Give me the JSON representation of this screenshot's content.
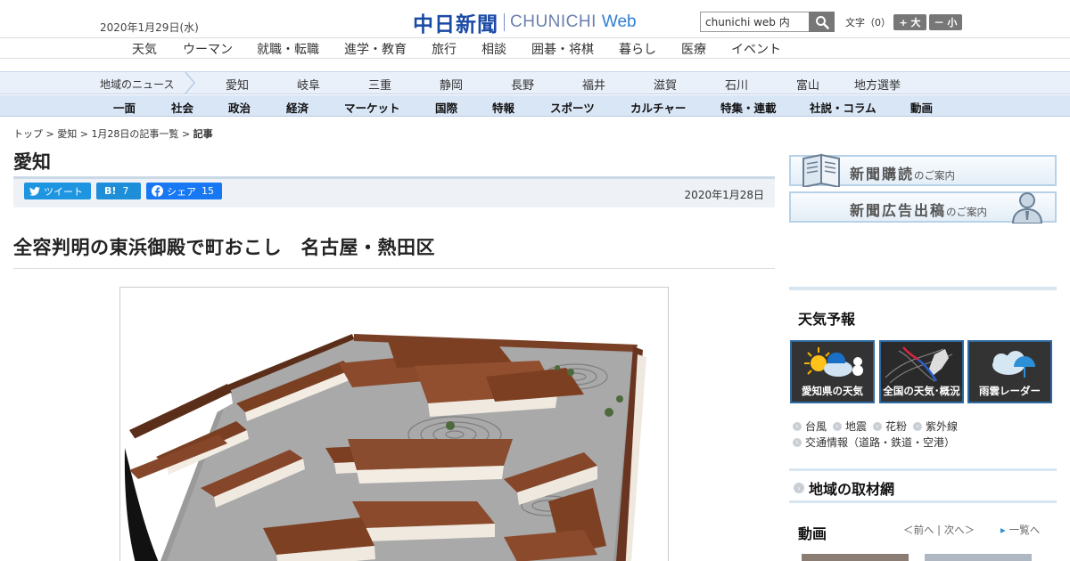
{
  "header": {
    "date": "2020年1月29日(水)",
    "logo_jp": "中日新聞",
    "logo_en": "CHUNICHI",
    "logo_web": "Web",
    "search_value": "chunichi web 内",
    "font_size_label": "文字（0）",
    "font_large": "+ 大",
    "font_small": "－ 小"
  },
  "category_nav": [
    "天気",
    "ウーマン",
    "就職・転職",
    "進学・教育",
    "旅行",
    "相談",
    "囲碁・将棋",
    "暮らし",
    "医療",
    "イベント"
  ],
  "region_nav": {
    "title": "地域のニュース",
    "items": [
      "愛知",
      "岐阜",
      "三重",
      "静岡",
      "長野",
      "福井",
      "滋賀",
      "石川",
      "富山",
      "地方選挙"
    ]
  },
  "section_nav": [
    "一面",
    "社会",
    "政治",
    "経済",
    "マーケット",
    "国際",
    "特報",
    "スポーツ",
    "カルチャー",
    "特集・連載",
    "社説・コラム",
    "動画"
  ],
  "breadcrumb": [
    "トップ",
    "愛知",
    "1月28日の記事一覧",
    "記事"
  ],
  "article": {
    "section": "愛知",
    "tweet_label": "ツイート",
    "hatena_label": "B!",
    "hatena_count": "7",
    "share_label": "シェア",
    "share_count": "15",
    "date": "2020年1月28日",
    "headline": "全容判明の東浜御殿で町おこし　名古屋・熱田区"
  },
  "sidebar": {
    "subscribe_main": "新聞購読",
    "subscribe_sub": "のご案内",
    "ads_main": "新聞広告出稿",
    "ads_sub": "のご案内",
    "weather_title": "天気予報",
    "weather_tiles": [
      "愛知県の天気",
      "全国の天気･概況",
      "雨雲レーダー"
    ],
    "weather_links_row1": [
      "台風",
      "地震",
      "花粉",
      "紫外線"
    ],
    "weather_links_row2": [
      "交通情報（道路・鉄道・空港）"
    ],
    "region_network": "地域の取材網",
    "video_title": "動画",
    "video_prev": "＜前へ",
    "video_next": "次へ＞",
    "video_list": "一覧へ"
  },
  "colors": {
    "logo_blue": "#1a4aa6",
    "twitter": "#1d95e0",
    "hatena": "#1f8ed8",
    "facebook": "#1877f2",
    "region_bar": "#e9f0fa",
    "section_bar": "#d9e6f6",
    "weather_tile_border": "#2d6aa1"
  },
  "icons": [
    "search-icon",
    "twitter-bird-icon",
    "facebook-icon",
    "book-icon",
    "person-icon",
    "sun-cloud-icon",
    "weather-map-icon",
    "rain-cloud-icon"
  ]
}
